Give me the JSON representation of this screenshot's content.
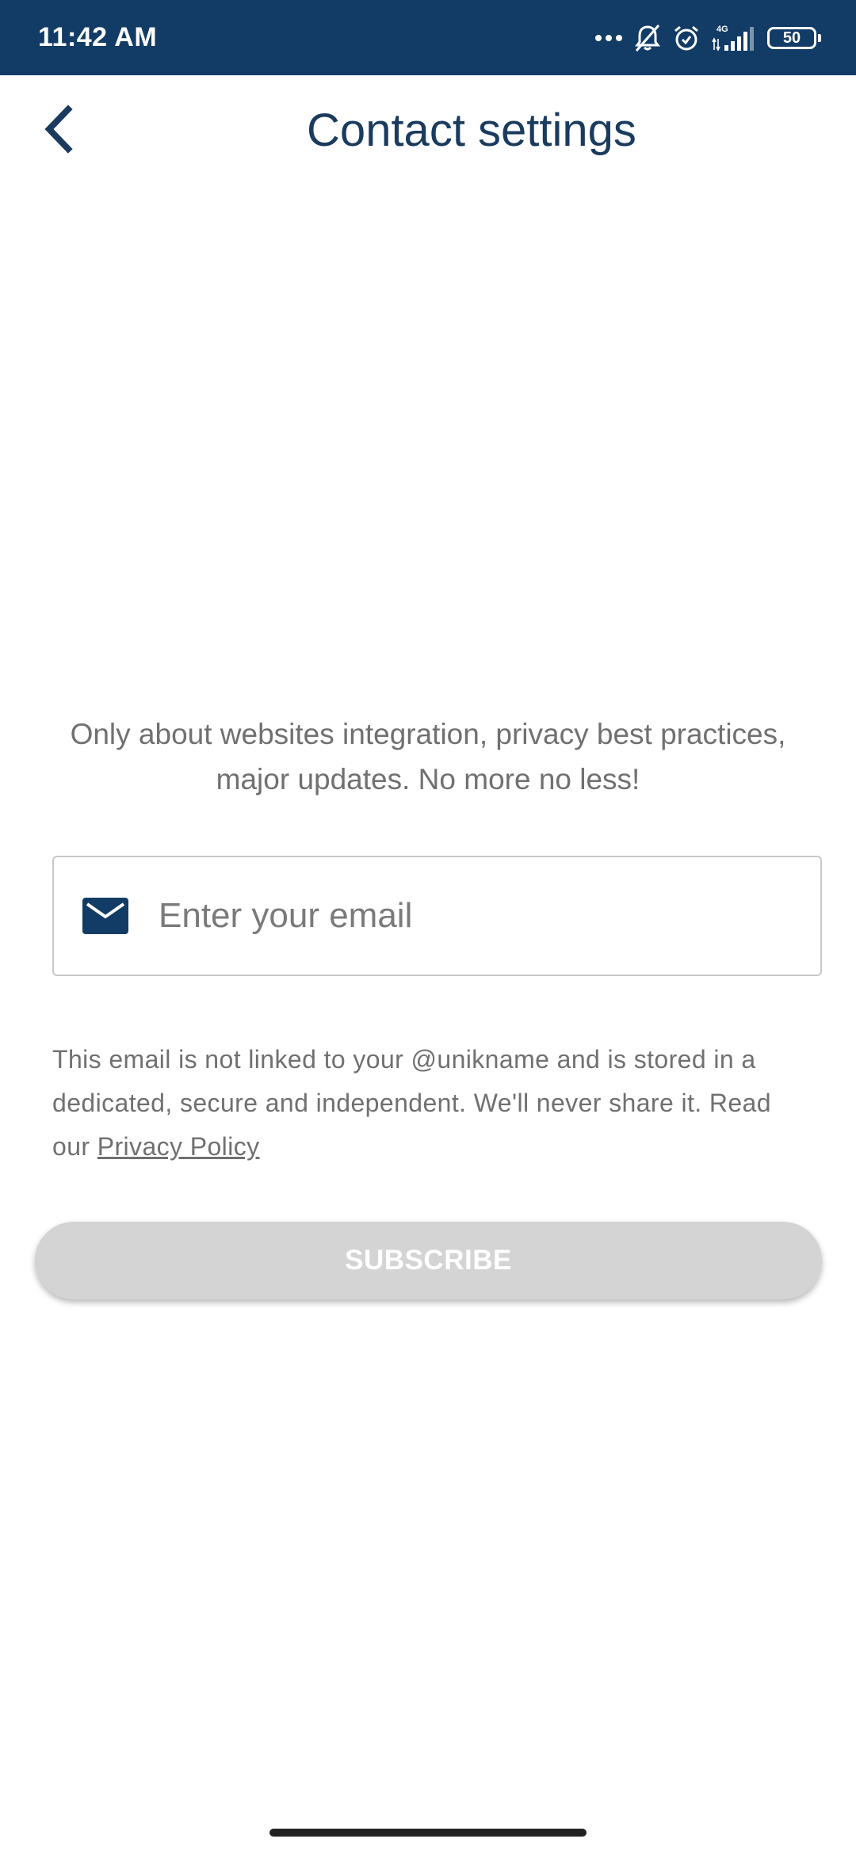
{
  "status_bar": {
    "time": "11:42 AM",
    "network": "4G",
    "battery": "50",
    "icons": [
      "more-dots-icon",
      "notifications-off-icon",
      "alarm-icon",
      "signal-4g-icon",
      "battery-icon"
    ],
    "background": "#123c65"
  },
  "header": {
    "title": "Contact settings",
    "back_icon": "chevron-left-icon"
  },
  "content": {
    "intro": "Only about websites integration, privacy best practices, major updates. No more no less!",
    "email": {
      "placeholder": "Enter your email",
      "value": "",
      "icon": "mail-icon"
    },
    "disclaimer_text": "This email is not linked to your @unikname and is stored in a dedicated, secure and independent. We'll never share it. Read our ",
    "privacy_link": "Privacy Policy",
    "subscribe_label": "SUBSCRIBE"
  },
  "colors": {
    "primary": "#123c65",
    "title": "#1a3b5e",
    "text_muted": "#707070",
    "button_disabled": "#d4d4d4"
  }
}
